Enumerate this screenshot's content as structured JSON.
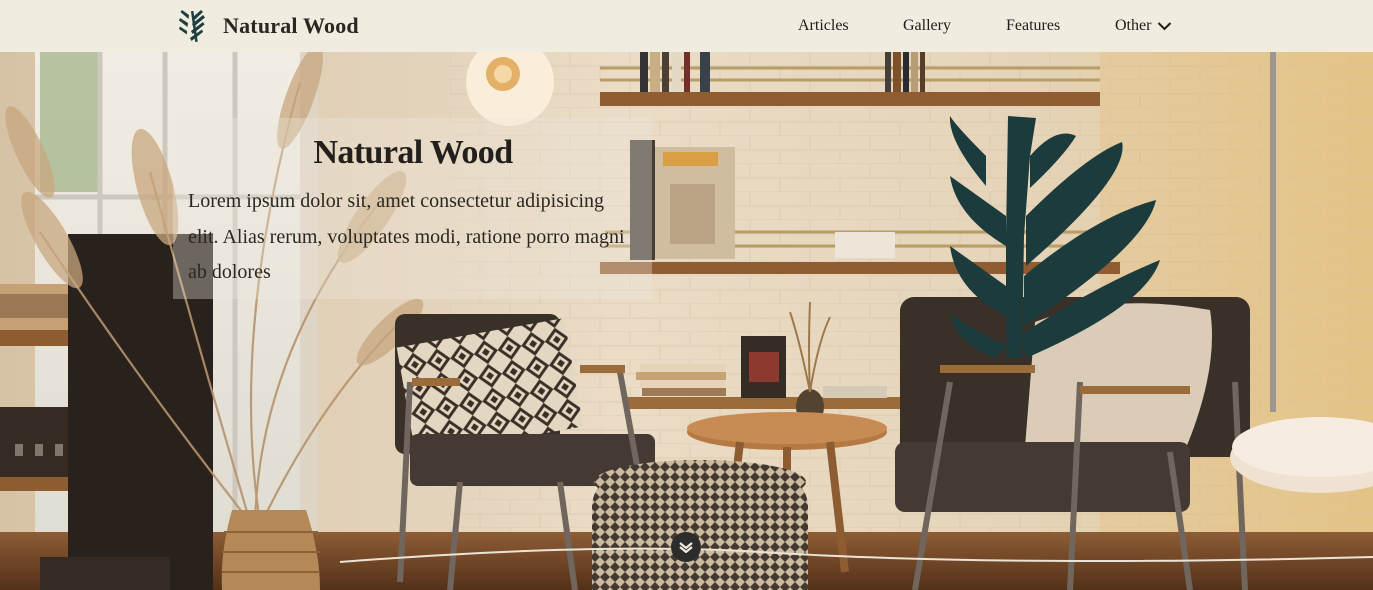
{
  "header": {
    "brand_name": "Natural Wood",
    "brand_icon": "leaf-icon",
    "nav": [
      {
        "label": "Articles"
      },
      {
        "label": "Gallery"
      },
      {
        "label": "Features"
      },
      {
        "label": "Other",
        "icon": "chevron-down-icon"
      }
    ]
  },
  "hero": {
    "title": "Natural Wood",
    "text": "Lorem ipsum dolor sit, amet consectetur adipisicing elit. Alias rerum, voluptates modi, ratione porro magni ab dolores",
    "decorative_icon": "leaf-icon",
    "scroll_icon": "chevron-down-icon"
  },
  "colors": {
    "header_bg": "#f0ece0",
    "leaf": "#1f3e3d",
    "text": "#23201c"
  }
}
